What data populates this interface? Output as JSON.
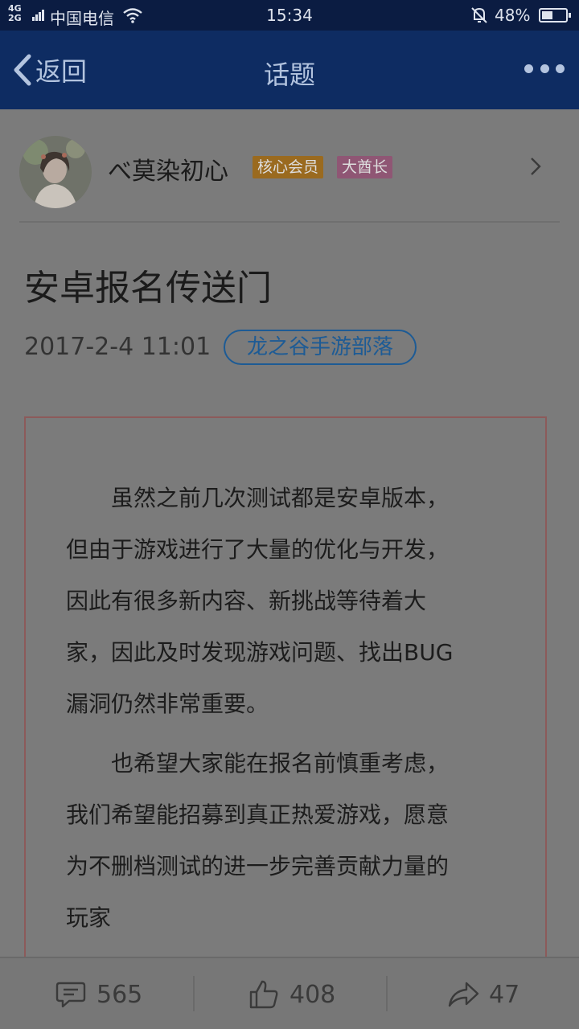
{
  "status_bar": {
    "network_top": "4G",
    "network_bottom": "2G",
    "carrier": "中国电信",
    "time": "15:34",
    "battery_pct": "48%",
    "battery_level": 0.48,
    "icons": [
      "signal-icon",
      "wifi-icon",
      "bell-muted-icon",
      "battery-icon"
    ]
  },
  "nav": {
    "back_label": "返回",
    "title": "话题",
    "icons": [
      "back-chevron-icon",
      "more-icon"
    ]
  },
  "author": {
    "name": "べ莫染初心",
    "badges": [
      {
        "label": "核心会员",
        "color": "#9a6a1f"
      },
      {
        "label": "大酋长",
        "color": "#8f5674"
      }
    ]
  },
  "post": {
    "title": "安卓报名传送门",
    "date": "2017-2-4 11:01",
    "tag": "龙之谷手游部落",
    "paragraph1_lines": [
      "　　虽然之前几次测试都是安卓版本，",
      "但由于游戏进行了大量的优化与开发，",
      "因此有很多新内容、新挑战等待着大",
      "家，因此及时发现游戏问题、找出BUG",
      "漏洞仍然非常重要。"
    ],
    "paragraph2_lines": [
      "　　也希望大家能在报名前慎重考虑，",
      "我们希望能招募到真正热爱游戏，愿意",
      "为不删档测试的进一步完善贡献力量的",
      "玩家"
    ]
  },
  "actions": {
    "comments": "565",
    "likes": "408",
    "shares": "47",
    "icons": [
      "comment-icon",
      "like-icon",
      "share-icon"
    ]
  },
  "colors": {
    "overlay_bg": "#7b7b7b",
    "nav_bg": "#0e2c62",
    "tag_blue": "#1d5b95"
  }
}
